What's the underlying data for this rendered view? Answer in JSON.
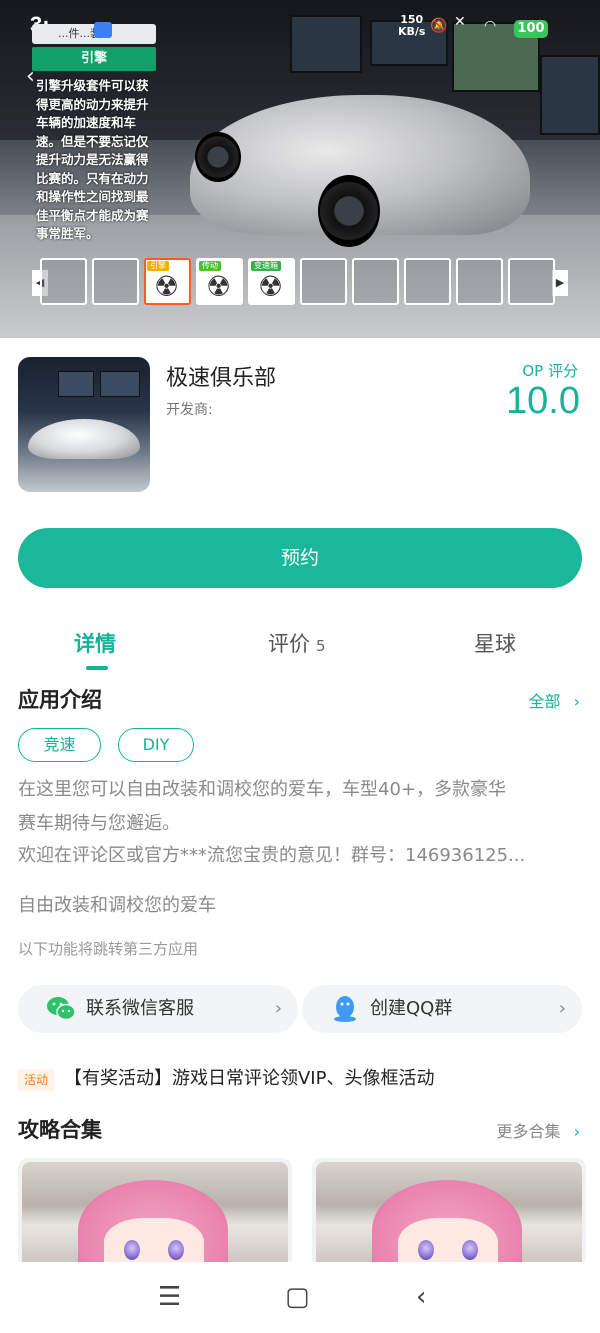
{
  "status_bar": {
    "time": "3:",
    "speed_value": "150",
    "speed_unit": "KB/s",
    "battery": "100"
  },
  "game_ui": {
    "hint_text": "...件...装",
    "engine_tab": "引擎",
    "engine_desc": "引擎升级套件可以获得更高的动力来提升车辆的加速度和车速。但是不要忘记仅提升动力是无法赢得比赛的。只有在动力和操作性之间找到最佳平衡点才能成为赛事常胜军。",
    "slot_tags": [
      "引擎",
      "传动",
      "变速箱"
    ]
  },
  "app": {
    "name": "极速俱乐部",
    "developer_label": "开发商:",
    "rating_label": "OP 评分",
    "rating_value": "10.0",
    "reserve_label": "预约"
  },
  "tabs": {
    "details": "详情",
    "reviews": "评价",
    "reviews_count": "5",
    "planet": "星球"
  },
  "intro": {
    "title": "应用介绍",
    "all_link": "全部",
    "tags": [
      "竞速",
      "DIY"
    ],
    "desc_line1": "在这里您可以自由改装和调校您的爱车，车型40+，多款豪华",
    "desc_line2": "赛车期待与您邂逅。",
    "desc_line3": "欢迎在评论区或官方***流您宝贵的意见！群号：146936125...",
    "summary": "自由改装和调校您的爱车",
    "third_party_note": "以下功能将跳转第三方应用"
  },
  "services": {
    "wechat_label": "联系微信客服",
    "qq_label": "创建QQ群"
  },
  "activity": {
    "badge": "活动",
    "text": "【有奖活动】游戏日常评论领VIP、头像框活动"
  },
  "guides": {
    "title": "攻略合集",
    "more_link": "更多合集"
  },
  "colors": {
    "accent": "#1bb79a",
    "activity_orange": "#ff7a1a",
    "selected_slot": "#ff5a1f"
  }
}
